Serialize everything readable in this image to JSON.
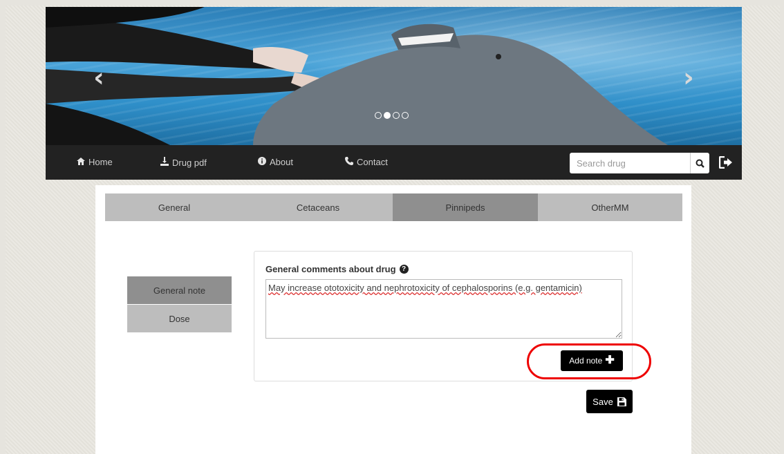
{
  "carousel": {
    "prev_glyph": "‹",
    "next_glyph": "›",
    "slide_count": 4,
    "active_slide": 2
  },
  "navbar": {
    "items": [
      {
        "label": "Home",
        "icon": "home-icon"
      },
      {
        "label": "Drug pdf",
        "icon": "download-icon"
      },
      {
        "label": "About",
        "icon": "info-icon"
      },
      {
        "label": "Contact",
        "icon": "phone-icon"
      }
    ],
    "search_placeholder": "Search drug",
    "search_icon": "search-icon",
    "logout_icon": "logout-icon"
  },
  "tabs": [
    {
      "label": "General",
      "active": false
    },
    {
      "label": "Cetaceans",
      "active": false
    },
    {
      "label": "Pinnipeds",
      "active": true
    },
    {
      "label": "OtherMM",
      "active": false
    }
  ],
  "side_menu": [
    {
      "label": "General note",
      "active": true
    },
    {
      "label": "Dose",
      "active": false
    }
  ],
  "panel": {
    "title": "General comments about drug",
    "help_icon_glyph": "?",
    "comment_value": "May increase ototoxicity and nephrotoxicity of cephalosporins (e.g. gentamicin)",
    "add_note_label": "Add note",
    "add_note_glyph": "✚"
  },
  "save": {
    "label": "Save",
    "icon": "save-icon"
  },
  "colors": {
    "navbar_bg": "#222222",
    "tab_bg": "#bdbdbd",
    "tab_active_bg": "#8f8f8f",
    "button_bg": "#000000",
    "highlight": "#ee0000"
  }
}
